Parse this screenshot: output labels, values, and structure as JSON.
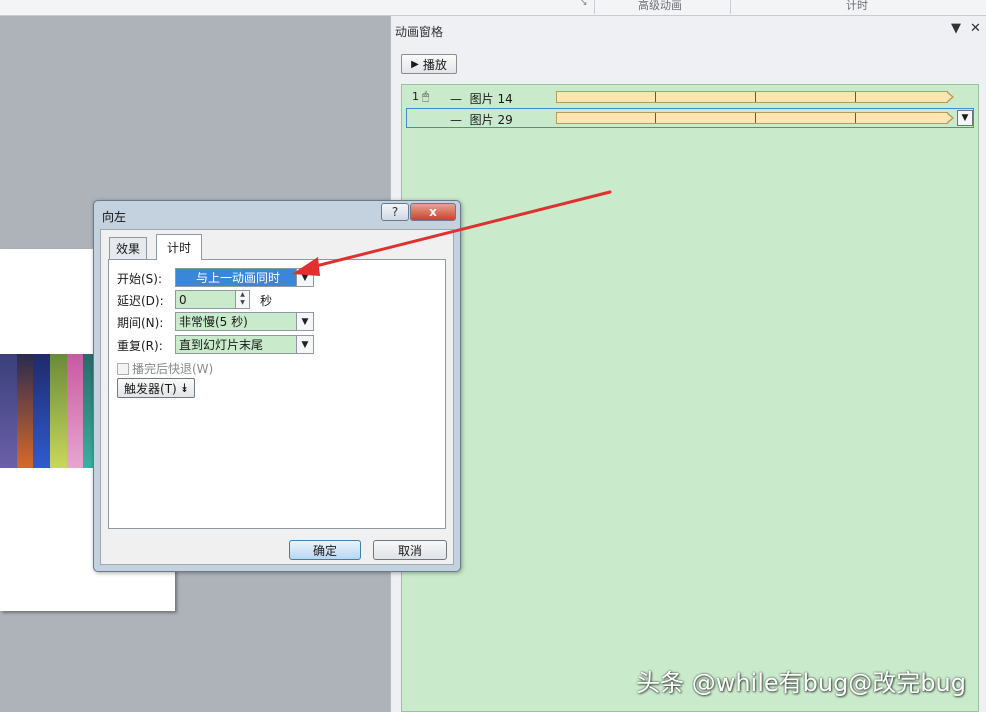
{
  "ribbon": {
    "group_advanced_animation": "高级动画",
    "group_timing": "计时"
  },
  "pane": {
    "title": "动画窗格",
    "dropdown_glyph": "▼",
    "close_glyph": "✕",
    "play_label": "播放",
    "items": [
      {
        "index": "1",
        "dash": "—",
        "name": "图片 14",
        "trigger": "on-click"
      },
      {
        "index": "",
        "dash": "—",
        "name": "图片 29",
        "trigger": "with-previous"
      }
    ]
  },
  "dialog": {
    "title": "向左",
    "help_glyph": "?",
    "close_glyph": "x",
    "tabs": [
      "效果",
      "计时"
    ],
    "active_tab": "计时",
    "fields": {
      "start_label": "开始(S):",
      "start_value": "与上一动画同时",
      "delay_label": "延迟(D):",
      "delay_value": "0",
      "delay_unit": "秒",
      "duration_label": "期间(N):",
      "duration_value": "非常慢(5 秒)",
      "repeat_label": "重复(R):",
      "repeat_value": "直到幻灯片末尾"
    },
    "rewind_label": "播完后快退(W)",
    "rewind_checked": false,
    "trigger_label": "触发器(T)",
    "ok_label": "确定",
    "cancel_label": "取消"
  },
  "colors": {
    "pane_list_bg": "#c9ebcb",
    "timeline_bar": "#fde6b0",
    "selection_border": "#3b8fd4",
    "highlight_field": "#3a86d8",
    "annotation_arrow": "#e03030"
  },
  "watermark": "头条 @while有bug@改完bug"
}
